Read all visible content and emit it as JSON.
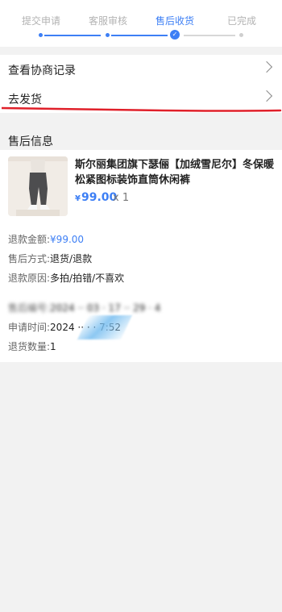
{
  "steps": [
    {
      "label": "提交申请",
      "state": "done"
    },
    {
      "label": "客服审核",
      "state": "done"
    },
    {
      "label": "售后收货",
      "state": "current"
    },
    {
      "label": "已完成",
      "state": "todo"
    }
  ],
  "menu": {
    "negotiation_label": "查看协商记录",
    "ship_label": "去发货"
  },
  "section_title": "售后信息",
  "product": {
    "title": "斯尔丽集团旗下瑟俪【加绒雪尼尔】冬保暖松紧图标装饰直筒休闲裤",
    "currency": "¥",
    "price": "99.00",
    "qty": "x 1"
  },
  "details": {
    "refund_amount_key": "退款金额:",
    "refund_amount_val": "¥99.00",
    "method_key": "售后方式:",
    "method_val": "退货/退款",
    "reason_key": "退款原因:",
    "reason_val": "多拍/拍错/不喜欢",
    "order_no_key": "售后编号:",
    "order_no_val": "2024 ·· 03 · 17 ·· 29 · 4",
    "time_key": "申请时间:",
    "time_val": "2024 ·· · · 7:52",
    "qty_key": "退货数量:",
    "qty_val": "1"
  },
  "colors": {
    "accent": "#3d7ff5",
    "annotation": "#e0202a"
  }
}
